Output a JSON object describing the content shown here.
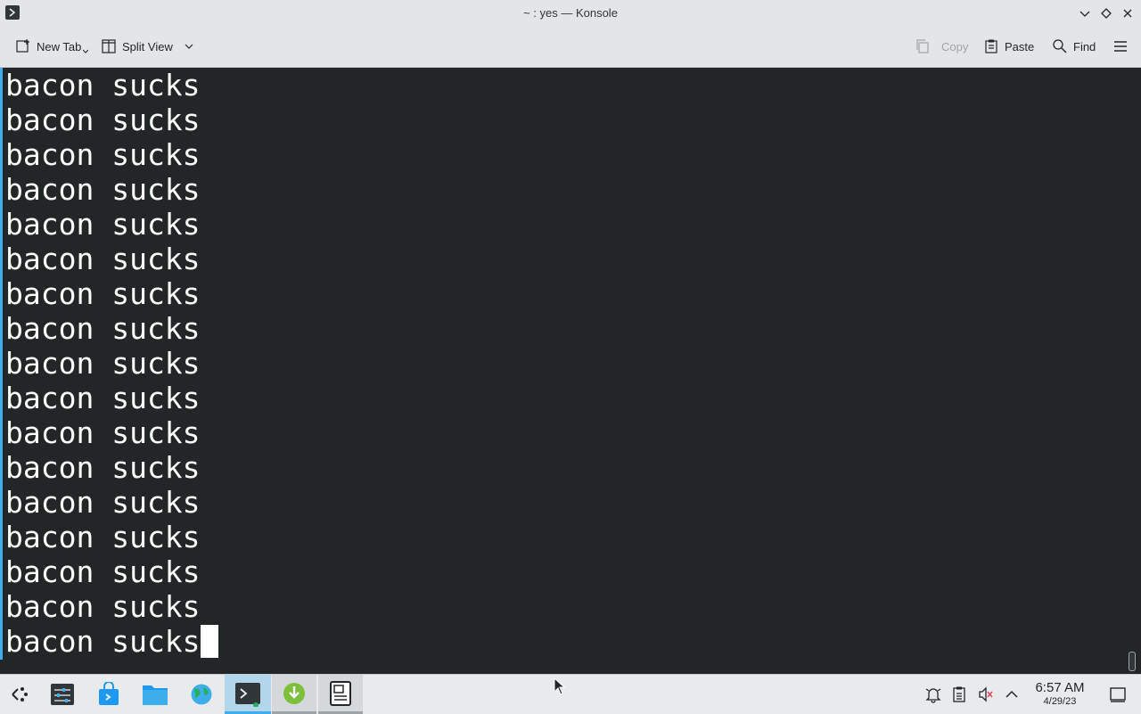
{
  "window": {
    "title": "~ : yes — Konsole"
  },
  "toolbar": {
    "new_tab": "New Tab",
    "split_view": "Split View",
    "copy": "Copy",
    "paste": "Paste",
    "find": "Find"
  },
  "terminal": {
    "lines": [
      "bacon sucks",
      "bacon sucks",
      "bacon sucks",
      "bacon sucks",
      "bacon sucks",
      "bacon sucks",
      "bacon sucks",
      "bacon sucks",
      "bacon sucks",
      "bacon sucks",
      "bacon sucks",
      "bacon sucks",
      "bacon sucks",
      "bacon sucks",
      "bacon sucks",
      "bacon sucks",
      "bacon sucks"
    ]
  },
  "taskbar": {
    "clock_time": "6:57 AM",
    "clock_date": "4/29/23"
  },
  "colors": {
    "terminal_bg": "#232627",
    "terminal_fg": "#fcfcfc",
    "accent": "#3daee9"
  }
}
